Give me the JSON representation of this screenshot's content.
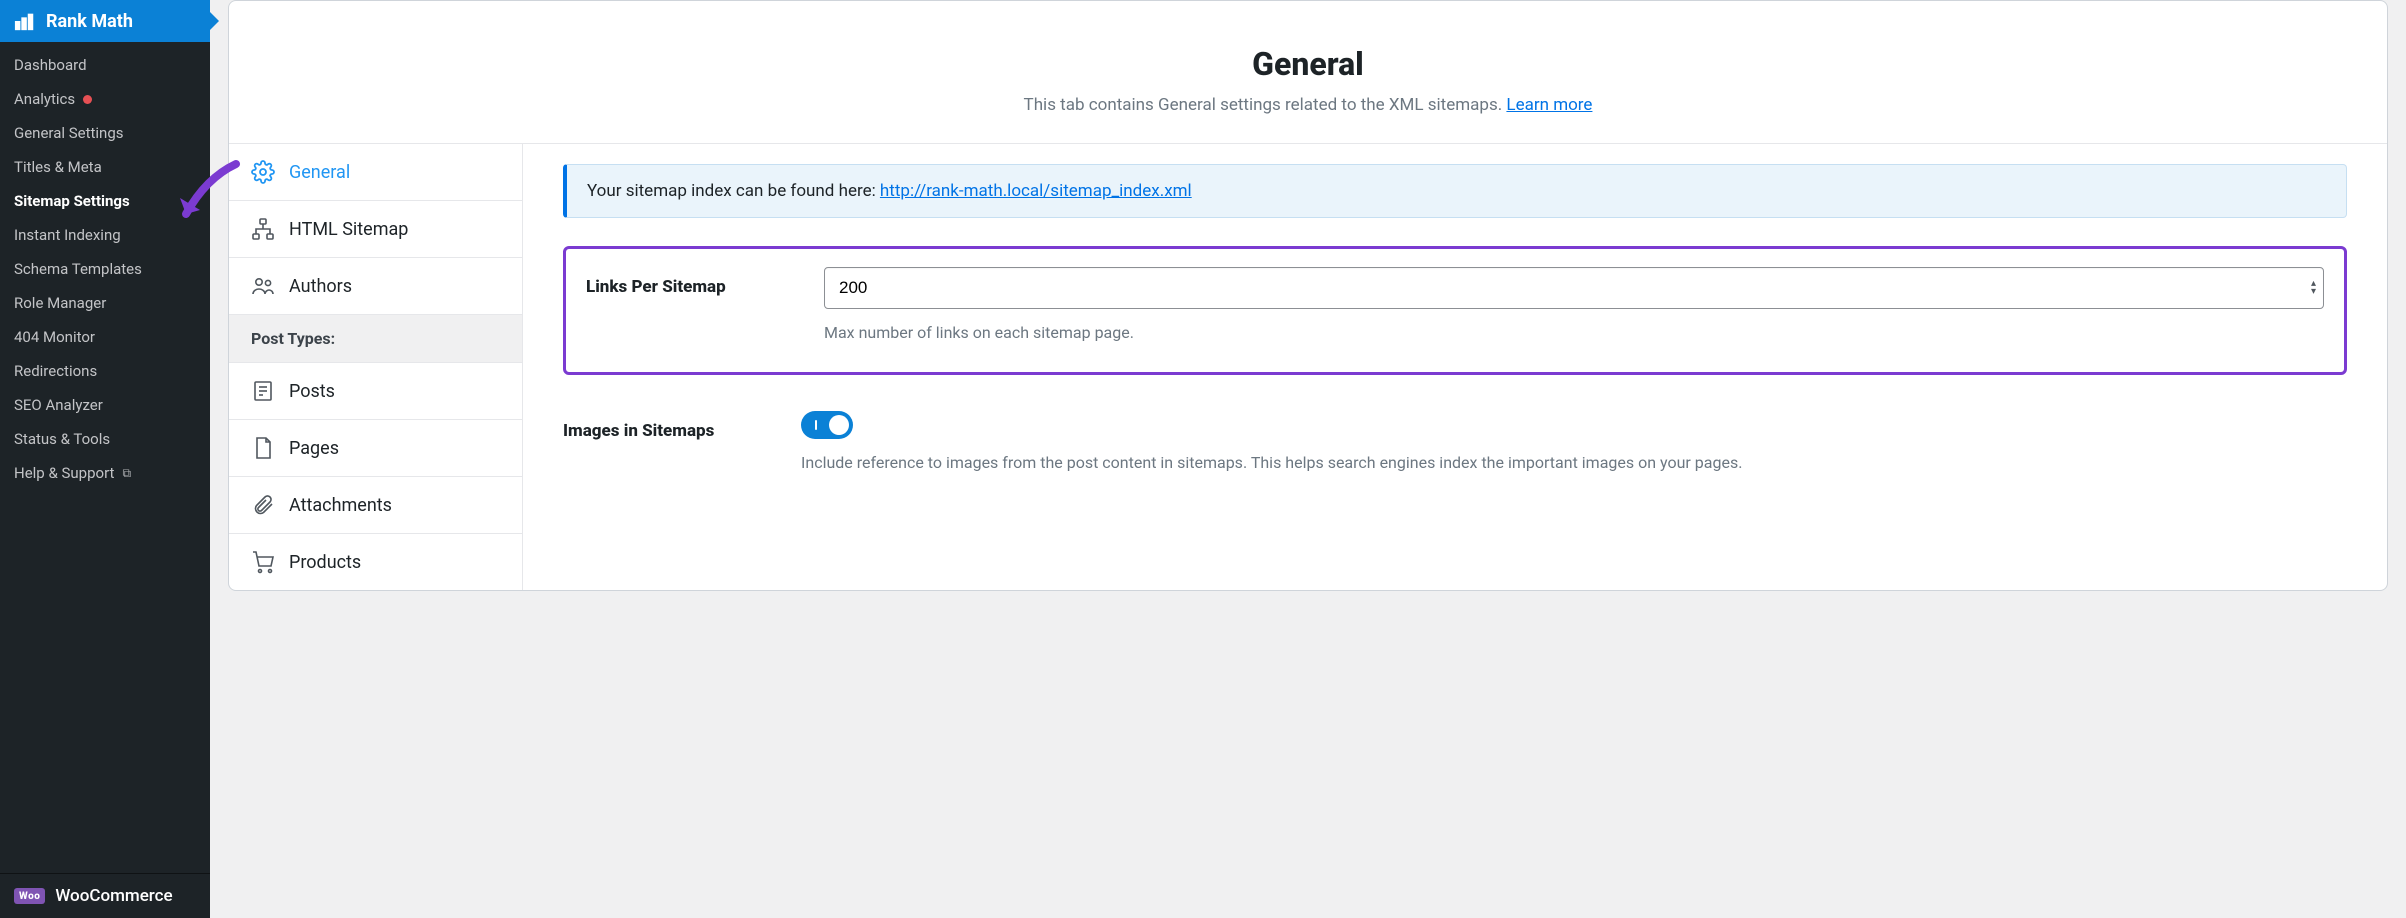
{
  "plugin_header": "Rank Math",
  "sidebar": {
    "items": [
      {
        "label": "Dashboard",
        "current": false,
        "dot": false
      },
      {
        "label": "Analytics",
        "current": false,
        "dot": true
      },
      {
        "label": "General Settings",
        "current": false,
        "dot": false
      },
      {
        "label": "Titles & Meta",
        "current": false,
        "dot": false
      },
      {
        "label": "Sitemap Settings",
        "current": true,
        "dot": false
      },
      {
        "label": "Instant Indexing",
        "current": false,
        "dot": false
      },
      {
        "label": "Schema Templates",
        "current": false,
        "dot": false
      },
      {
        "label": "Role Manager",
        "current": false,
        "dot": false
      },
      {
        "label": "404 Monitor",
        "current": false,
        "dot": false
      },
      {
        "label": "Redirections",
        "current": false,
        "dot": false
      },
      {
        "label": "SEO Analyzer",
        "current": false,
        "dot": false
      },
      {
        "label": "Status & Tools",
        "current": false,
        "dot": false
      },
      {
        "label": "Help & Support",
        "current": false,
        "dot": false,
        "external": true
      }
    ],
    "footer_label": "WooCommerce",
    "footer_badge": "Woo"
  },
  "header": {
    "title": "General",
    "subtitle": "This tab contains General settings related to the XML sitemaps.",
    "learn_more": "Learn more"
  },
  "tabs": [
    {
      "id": "general",
      "label": "General",
      "active": true
    },
    {
      "id": "html-sitemap",
      "label": "HTML Sitemap"
    },
    {
      "id": "authors",
      "label": "Authors"
    }
  ],
  "section_label": "Post Types:",
  "post_types": [
    {
      "id": "posts",
      "label": "Posts"
    },
    {
      "id": "pages",
      "label": "Pages"
    },
    {
      "id": "attachments",
      "label": "Attachments"
    },
    {
      "id": "products",
      "label": "Products"
    }
  ],
  "content": {
    "notice_prefix": "Your sitemap index can be found here: ",
    "notice_url": "http://rank-math.local/sitemap_index.xml",
    "links_per_sitemap_label": "Links Per Sitemap",
    "links_per_sitemap_value": "200",
    "links_per_sitemap_help": "Max number of links on each sitemap page.",
    "images_label": "Images in Sitemaps",
    "images_on": true,
    "images_help": "Include reference to images from the post content in sitemaps. This helps search engines index the important images on your pages."
  }
}
